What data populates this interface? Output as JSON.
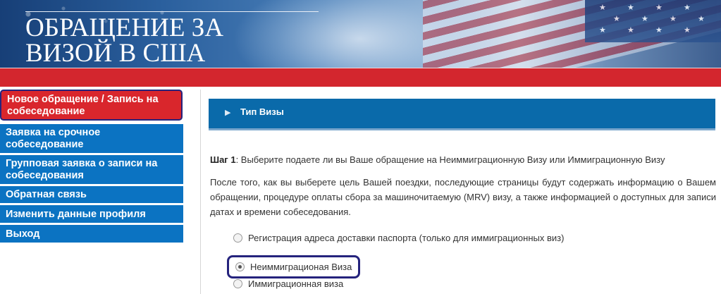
{
  "header": {
    "title_line1": "ОБРАЩЕНИЕ ЗА",
    "title_line2": "ВИЗОЙ В США"
  },
  "sidebar": {
    "items": [
      {
        "label": "Новое обращение / Запись на собеседование",
        "active": true
      },
      {
        "label": "Заявка на срочное собеседование",
        "active": false
      },
      {
        "label": "Групповая заявка о записи на собеседования",
        "active": false
      },
      {
        "label": "Обратная связь",
        "active": false
      },
      {
        "label": "Изменить данные профиля",
        "active": false
      },
      {
        "label": "Выход",
        "active": false
      }
    ]
  },
  "main": {
    "section_title": "Тип Визы",
    "step_label": "Шаг 1",
    "step_text": ": Выберите подаете ли вы Ваше обращение на Неиммиграционную Визу или Иммиграционную Визу",
    "description": "После того, как вы выберете цель Вашей поездки, последующие страницы будут содержать информацию о Вашем обращении, процедуре оплаты сбора за машиночитаемую (MRV) визу, а также информацией о доступных для записи датах и времени собеседования.",
    "options": [
      {
        "label": "Регистрация адреса доставки паспорта (только для иммиграционных виз)",
        "selected": false
      },
      {
        "label": "Неиммиграционая Виза",
        "selected": true
      },
      {
        "label": "Иммиграционная виза",
        "selected": false
      }
    ]
  },
  "colors": {
    "nav_blue": "#0b73c2",
    "nav_active_red": "#d9262c",
    "highlight_border": "#25237d",
    "section_header_blue": "#0a6aaa",
    "banner_red_bar": "#d3262e"
  }
}
